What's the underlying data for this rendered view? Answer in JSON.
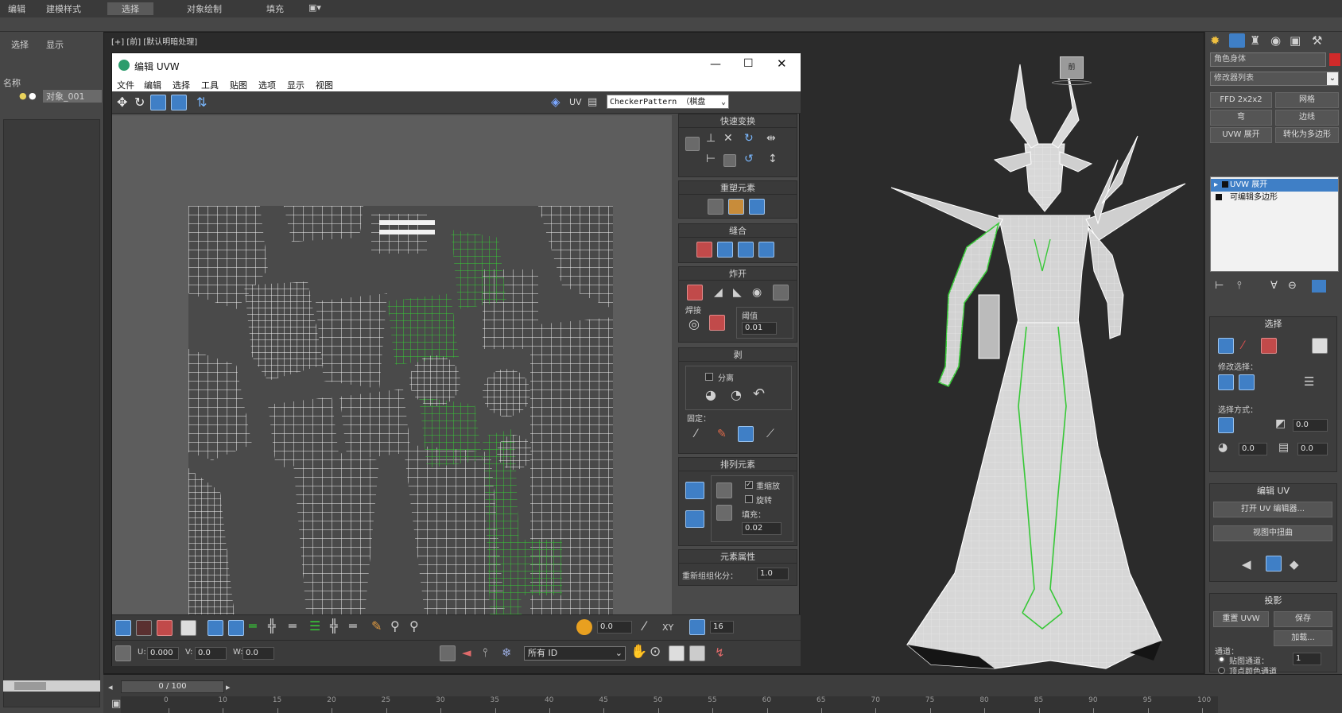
{
  "menubar": {
    "items": [
      "编辑",
      "建模样式",
      "选择",
      "对象绘制",
      "填充"
    ]
  },
  "viewport": {
    "label": "[+] [前] [默认明暗处理]",
    "cube_label": "前"
  },
  "left_panel": {
    "tabs": [
      "选择",
      "显示"
    ],
    "list_header": "名称",
    "selected_item": "对象_001"
  },
  "uvw_window": {
    "title": "编辑 UVW",
    "menu": [
      "文件",
      "编辑",
      "选择",
      "工具",
      "贴图",
      "选项",
      "显示",
      "视图"
    ],
    "uv_label": "UV",
    "texture_dropdown": "CheckerPattern （棋盘",
    "rollouts": {
      "quick_transform": "快速变换",
      "reshape": "重塑元素",
      "stitch": "缝合",
      "explode": "炸开",
      "weld_label": "焊接",
      "threshold_label": "阈值",
      "threshold_value": "0.01",
      "peel": "剥",
      "detach_label": "分离",
      "pins_label": "固定：",
      "arrange": "排列元素",
      "rescale_label": "重缩放",
      "rotate_label": "旋转",
      "padding_label": "填充：",
      "padding_value": "0.02",
      "element_props": "元素属性",
      "group_label": "重新组组化分：",
      "group_value": "1.0"
    },
    "bottom": {
      "angle_value": "0.0",
      "xy_label": "XY",
      "u_label": "U:",
      "u_value": "0.000",
      "v_label": "V:",
      "v_value": "0.0",
      "w_label": "W:",
      "w_value": "0.0",
      "all_ids": "所有 ID",
      "offset_value": "16"
    }
  },
  "command_panel": {
    "object_name": "角色身体",
    "modifier_list": "修改器列表",
    "buttons": [
      "FFD 2x2x2",
      "网格",
      "弯",
      "边线",
      "UVW 展开",
      "转化为多边形"
    ],
    "stack": [
      "UVW 展开",
      "可编辑多边形"
    ],
    "selection_title": "选择",
    "modify_selection": "修改选择：",
    "select_by": "选择方式：",
    "spin_a": "0.0",
    "spin_b": "0.0",
    "spin_c": "0.0",
    "edit_uvs_title": "编辑 UV",
    "open_uv_editor": "打开 UV 编辑器...",
    "tweak_in_view": "视图中扭曲",
    "projection_title": "投影",
    "reset_uvw": "重置 UVW",
    "save": "保存",
    "load": "加载...",
    "channel_label": "通道：",
    "map_channel": "贴图通道：",
    "map_channel_value": "1",
    "vertex_color": "顶点颜色通道"
  },
  "timeline": {
    "slider": "0 / 100",
    "ticks": [
      "0",
      "10",
      "15",
      "20",
      "25",
      "30",
      "35",
      "40",
      "45",
      "50",
      "55",
      "60",
      "65",
      "70",
      "75",
      "80",
      "85",
      "90",
      "95",
      "100"
    ]
  },
  "colors": {
    "accent": "#3f7fc6",
    "wire": "#f2f2f2",
    "selected_wire": "#37c837",
    "viewport_bg": "#2b2b2b",
    "uv_bg": "#5d5d5d"
  }
}
